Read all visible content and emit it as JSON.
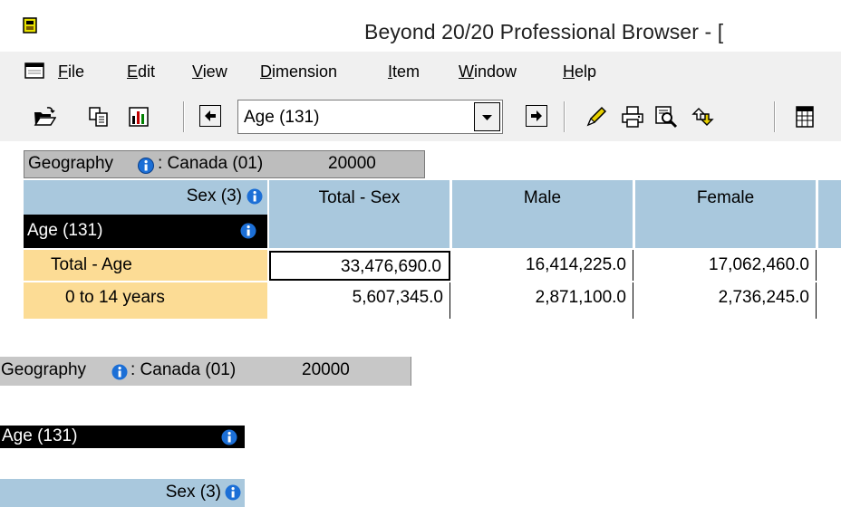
{
  "window": {
    "title": "Beyond 20/20 Professional Browser - ["
  },
  "menu": {
    "items": [
      {
        "label": "File",
        "key": "F",
        "rest": "ile"
      },
      {
        "label": "Edit",
        "key": "E",
        "rest": "dit"
      },
      {
        "label": "View",
        "key": "V",
        "rest": "iew"
      },
      {
        "label": "Dimension",
        "key": "D",
        "rest": "imension"
      },
      {
        "label": "Item",
        "key": "I",
        "rest": "tem"
      },
      {
        "label": "Window",
        "key": "W",
        "rest": "indow"
      },
      {
        "label": "Help",
        "key": "H",
        "rest": "elp"
      }
    ]
  },
  "toolbar": {
    "dimension_combo_value": "Age (131)",
    "icons": [
      "open-folder-icon",
      "copy-icon",
      "chart-icon",
      "prev-dimension-icon",
      "next-dimension-icon",
      "pencil-icon",
      "print-icon",
      "search-icon",
      "arrows-icon",
      "grid-icon"
    ]
  },
  "table": {
    "geography_label": "Geography",
    "geography_value": ": Canada (01)",
    "geography_code": "20000",
    "column_dimension": "Sex (3)",
    "row_dimension": "Age (131)",
    "columns": [
      "Total - Sex",
      "Male",
      "Female"
    ],
    "rows": [
      {
        "label": "Total - Age",
        "values": [
          "33,476,690.0",
          "16,414,225.0",
          "17,062,460.0"
        ]
      },
      {
        "label": "0 to 14 years",
        "values": [
          "5,607,345.0",
          "2,871,100.0",
          "2,736,245.0"
        ]
      }
    ]
  },
  "detail": {
    "geography_label": "Geography",
    "geography_value": ": Canada (01)",
    "geography_code": "20000",
    "row_dimension": "Age (131)",
    "column_dimension": "Sex (3)"
  },
  "colors": {
    "header_blue": "#a9c8dd",
    "row_header_yellow": "#fcdc95",
    "geography_gray": "#bdbdbd",
    "info_blue": "#1c6fd6",
    "selected_black": "#000000"
  }
}
